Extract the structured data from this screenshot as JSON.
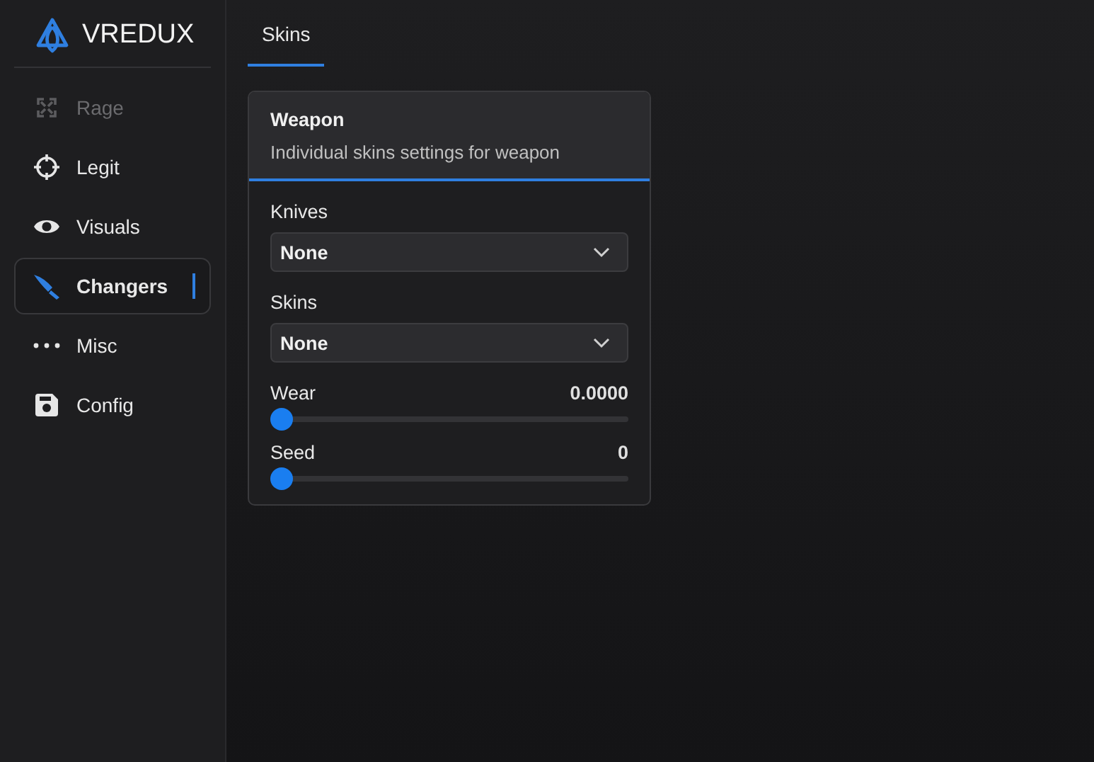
{
  "brand": {
    "name": "VREDUX"
  },
  "nav": [
    {
      "label": "Rage",
      "kind": "rage",
      "disabled": true,
      "selected": false
    },
    {
      "label": "Legit",
      "kind": "crosshair",
      "disabled": false,
      "selected": false
    },
    {
      "label": "Visuals",
      "kind": "eye",
      "disabled": false,
      "selected": false
    },
    {
      "label": "Changers",
      "kind": "knife",
      "disabled": false,
      "selected": true
    },
    {
      "label": "Misc",
      "kind": "dots",
      "disabled": false,
      "selected": false
    },
    {
      "label": "Config",
      "kind": "save",
      "disabled": false,
      "selected": false
    }
  ],
  "tabs": [
    {
      "label": "Skins",
      "selected": true
    }
  ],
  "panel": {
    "title": "Weapon",
    "subtitle": "Individual skins settings for weapon",
    "controls": [
      {
        "kind": "select",
        "label": "Knives",
        "value": "None"
      },
      {
        "kind": "select",
        "label": "Skins",
        "value": "None"
      },
      {
        "kind": "slider",
        "label": "Wear",
        "reading": "0.0000",
        "level": 0
      },
      {
        "kind": "slider",
        "label": "Seed",
        "reading": "0",
        "level": 0
      }
    ]
  }
}
